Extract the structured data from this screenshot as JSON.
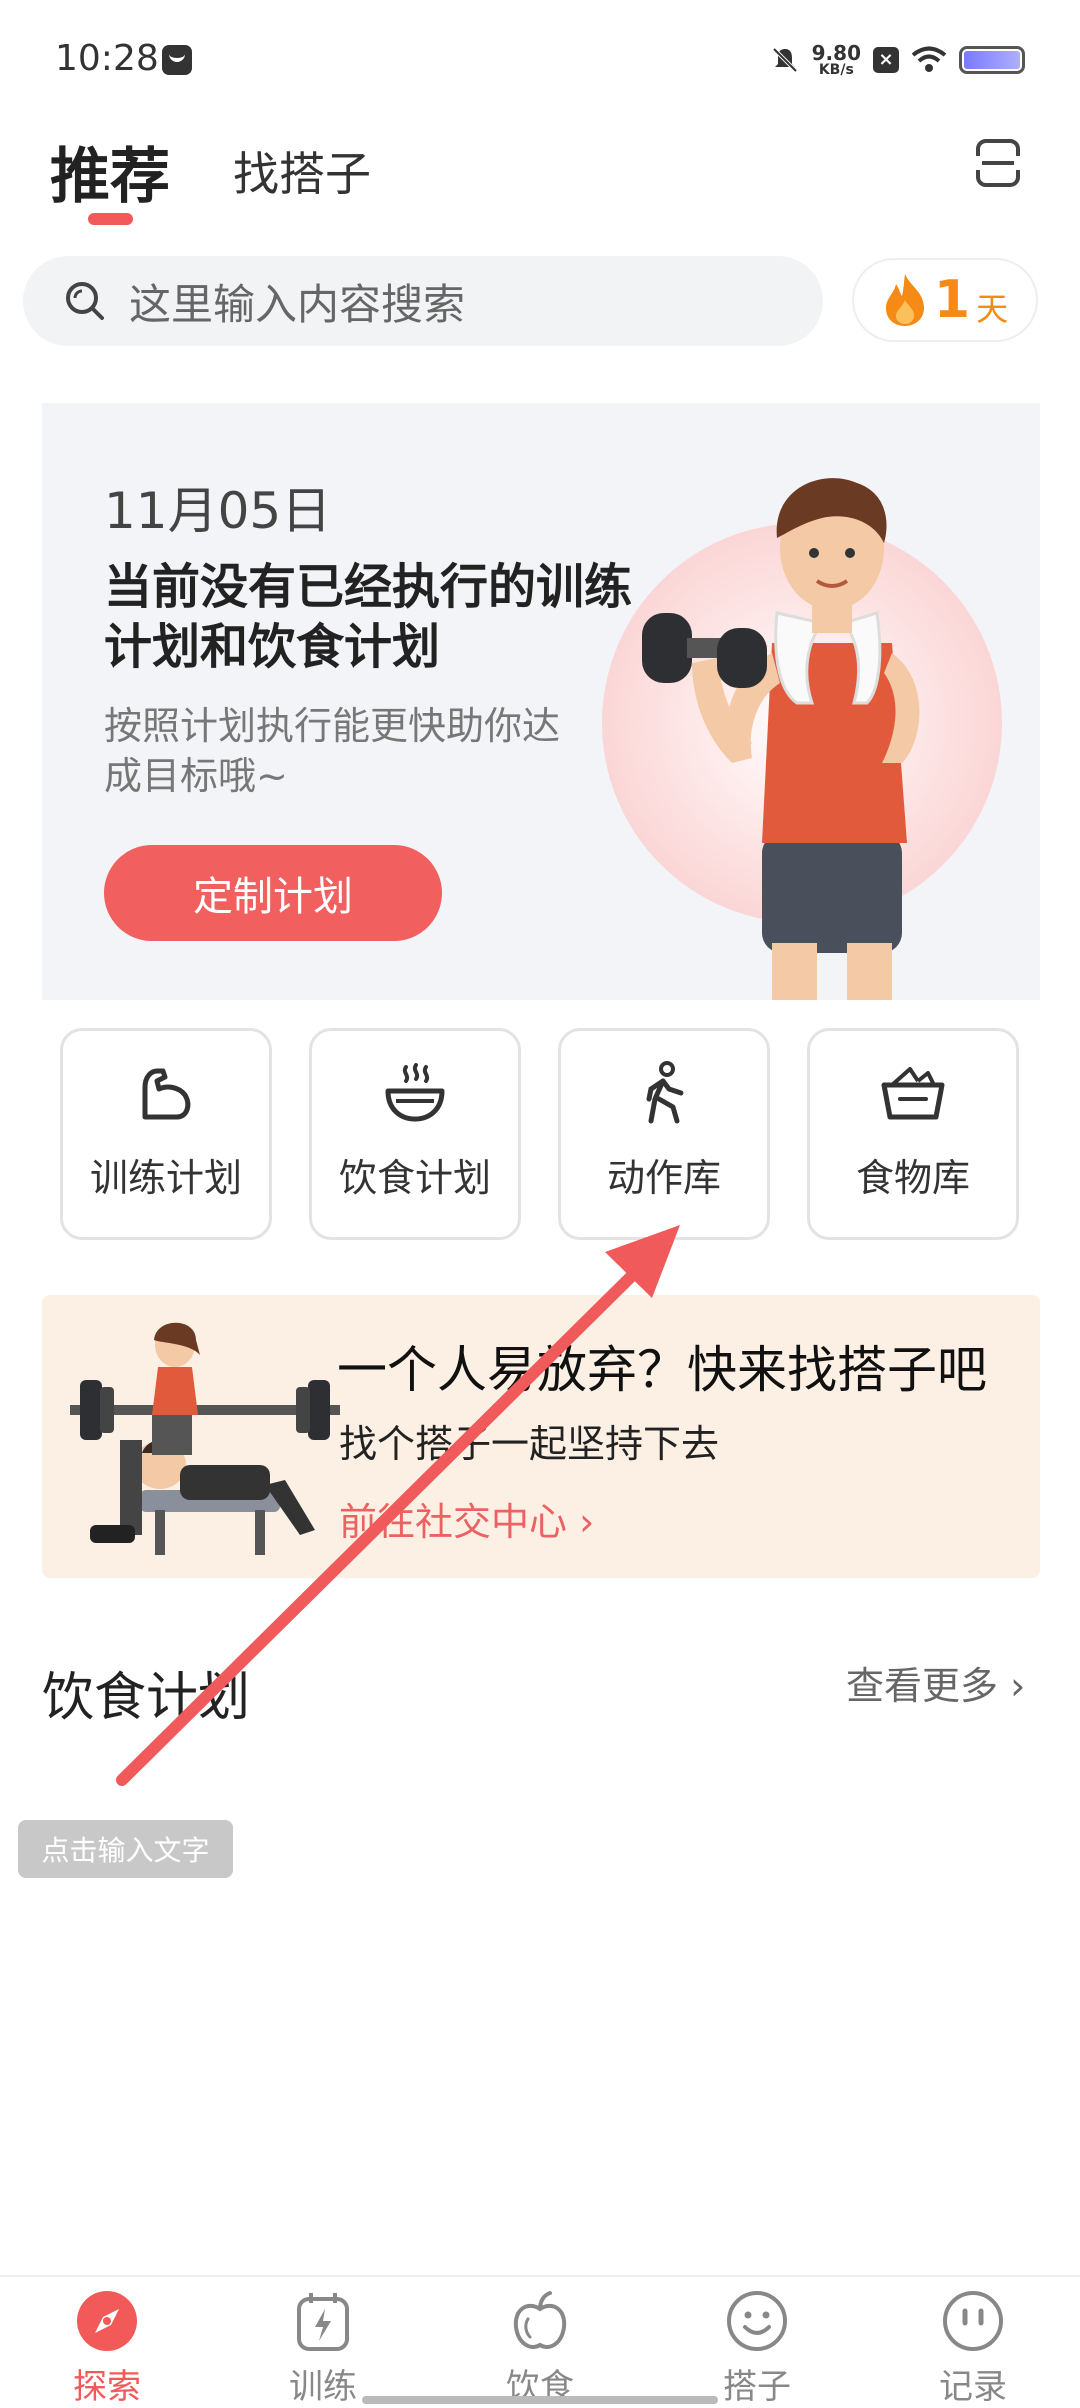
{
  "status_bar": {
    "time": "10:28",
    "net_speed_value": "9.80",
    "net_speed_unit": "KB/s",
    "x_badge": "×"
  },
  "header": {
    "tabs": [
      {
        "label": "推荐",
        "active": true
      },
      {
        "label": "找搭子",
        "active": false
      }
    ]
  },
  "search": {
    "placeholder": "这里输入内容搜索"
  },
  "streak": {
    "count": "1",
    "unit": "天"
  },
  "banner": {
    "date": "11月05日",
    "title": "当前没有已经执行的训练计划和饮食计划",
    "subtitle": "按照计划执行能更快助你达成目标哦~",
    "button_label": "定制计划"
  },
  "quick_actions": [
    {
      "label": "训练计划",
      "icon": "muscle-arm-icon"
    },
    {
      "label": "饮食计划",
      "icon": "food-bowl-icon"
    },
    {
      "label": "动作库",
      "icon": "exercise-person-icon"
    },
    {
      "label": "食物库",
      "icon": "food-basket-icon"
    }
  ],
  "buddy_card": {
    "title": "一个人易放弃？快来找搭子吧",
    "subtitle": "找个搭子一起坚持下去",
    "link": "前往社交中心 ›"
  },
  "diet_section": {
    "title": "饮食计划",
    "more": "查看更多 ›"
  },
  "annotation": {
    "input_hint": "点击输入文字",
    "arrow_color": "#f05a5a"
  },
  "bottom_nav": [
    {
      "label": "探索",
      "icon": "compass-icon",
      "active": true
    },
    {
      "label": "训练",
      "icon": "lightning-tablet-icon",
      "active": false
    },
    {
      "label": "饮食",
      "icon": "apple-icon",
      "active": false
    },
    {
      "label": "搭子",
      "icon": "smile-icon",
      "active": false
    },
    {
      "label": "记录",
      "icon": "face-dots-icon",
      "active": false
    }
  ],
  "colors": {
    "accent": "#f25a5a",
    "streak": "#f58a14",
    "buddy_bg": "#fcf0e4",
    "banner_bg": "#f3f4f7"
  }
}
